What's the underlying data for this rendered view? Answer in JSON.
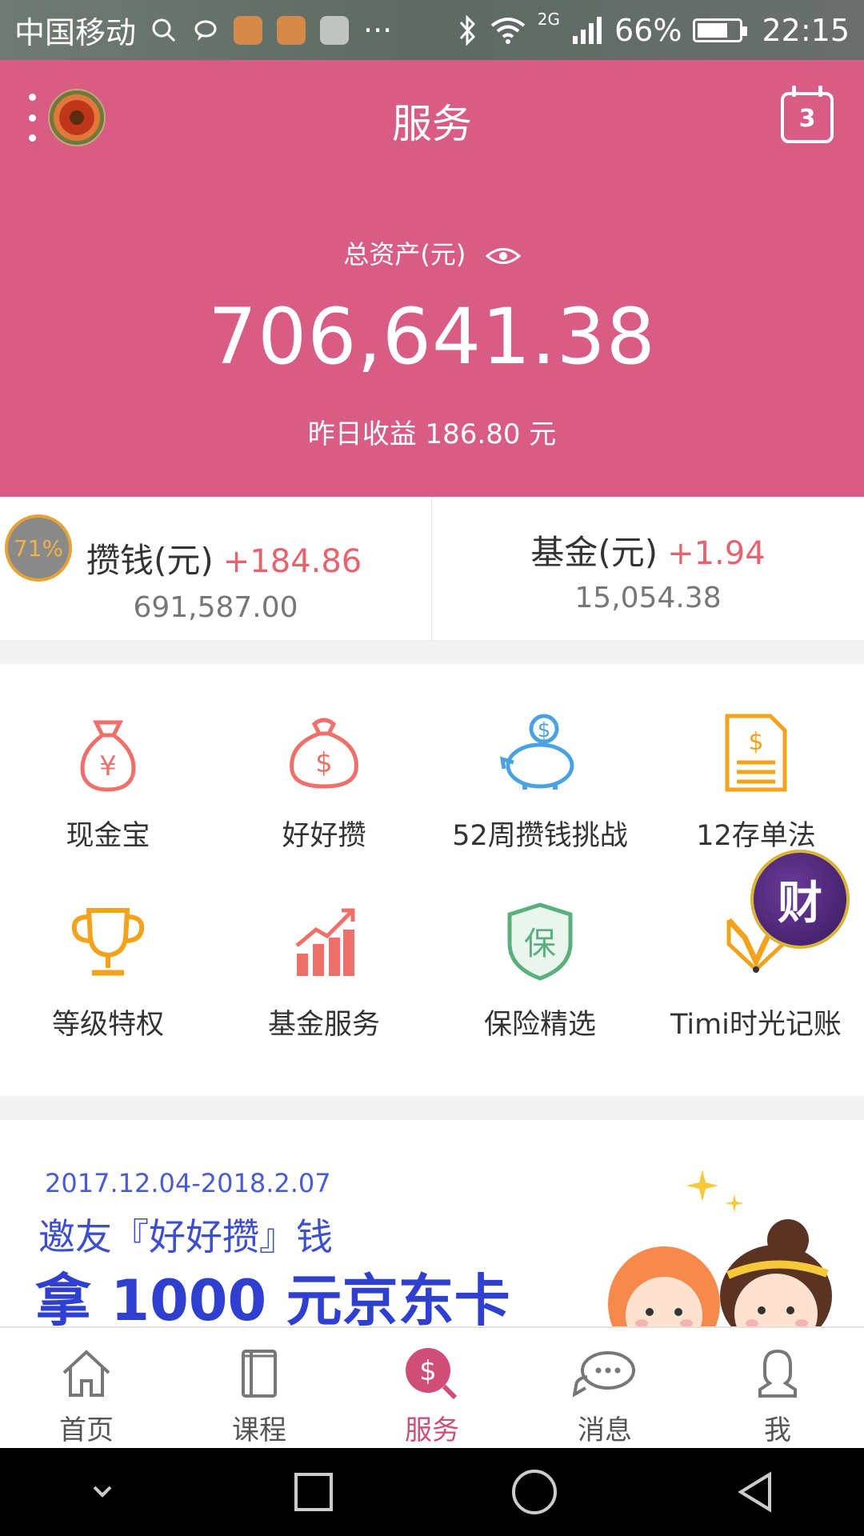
{
  "status_bar": {
    "carrier": "中国移动",
    "network": "2G",
    "battery": "66%",
    "battery_level": 0.66,
    "time": "22:15",
    "more": "···"
  },
  "header": {
    "title": "服务",
    "calendar_day": "3",
    "asset_label": "总资产(元)",
    "asset_amount": "706,641.38",
    "yesterday": "昨日收益 186.80 元"
  },
  "summary": {
    "left": {
      "badge": "71%",
      "title": "攒钱(元)",
      "delta": "+184.86",
      "value": "691,587.00"
    },
    "right": {
      "title": "基金(元)",
      "delta": "+1.94",
      "value": "15,054.38"
    }
  },
  "services": [
    {
      "label": "现金宝",
      "icon": "money-bag-yen-icon"
    },
    {
      "label": "好好攒",
      "icon": "money-bag-dollar-icon"
    },
    {
      "label": "52周攒钱挑战",
      "icon": "piggy-bank-icon"
    },
    {
      "label": "12存单法",
      "icon": "document-dollar-icon"
    },
    {
      "label": "等级特权",
      "icon": "trophy-icon"
    },
    {
      "label": "基金服务",
      "icon": "bar-chart-icon"
    },
    {
      "label": "保险精选",
      "icon": "shield-icon"
    },
    {
      "label": "Timi时光记账",
      "icon": "fox-icon"
    }
  ],
  "float_badge": "财",
  "banner": {
    "date": "2017.12.04-2018.2.07",
    "line1": "邀友『好好攒』钱",
    "line2": "拿 1000 元京东卡"
  },
  "tabs": [
    {
      "label": "首页",
      "icon": "home-icon"
    },
    {
      "label": "课程",
      "icon": "book-icon"
    },
    {
      "label": "服务",
      "icon": "service-dollar-icon",
      "active": true
    },
    {
      "label": "消息",
      "icon": "message-icon"
    },
    {
      "label": "我",
      "icon": "user-icon"
    }
  ],
  "colors": {
    "brand_pink": "#d85c84",
    "delta_red": "#e8626e",
    "active_tab": "#d04d77"
  }
}
